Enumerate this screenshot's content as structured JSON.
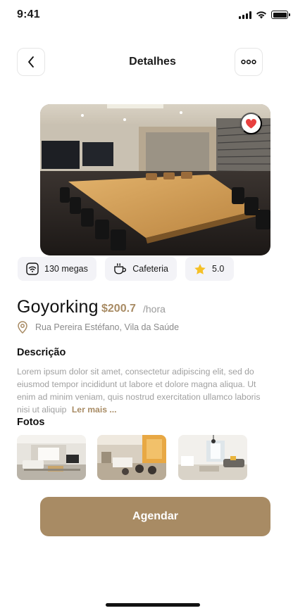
{
  "status_bar": {
    "time": "9:41"
  },
  "header": {
    "title": "Detalhes"
  },
  "hero": {
    "favorited": true,
    "accent": "#e8403f"
  },
  "amenities": [
    {
      "icon": "wifi-icon",
      "label": "130 megas"
    },
    {
      "icon": "coffee-cup-icon",
      "label": "Cafeteria"
    },
    {
      "icon": "star-icon",
      "label": "5.0"
    }
  ],
  "space": {
    "name": "Goyorking",
    "price": "$200.7",
    "price_unit": "/hora",
    "address": "Rua Pereira Estéfano, Vila da Saúde"
  },
  "description": {
    "heading": "Descrição",
    "text": "Lorem ipsum dolor sit amet, consectetur adipiscing elit, sed do eiusmod tempor incididunt ut labore et dolore magna aliqua. Ut enim ad minim veniam, quis nostrud exercitation ullamco laboris nisi ut aliquip",
    "read_more": "Ler mais ..."
  },
  "photos": {
    "heading": "Fotos",
    "count": 3
  },
  "cta": {
    "label": "Agendar"
  },
  "colors": {
    "accent": "#a88b64",
    "chip_bg": "#f3f3f7",
    "muted": "#a0a0a0"
  }
}
